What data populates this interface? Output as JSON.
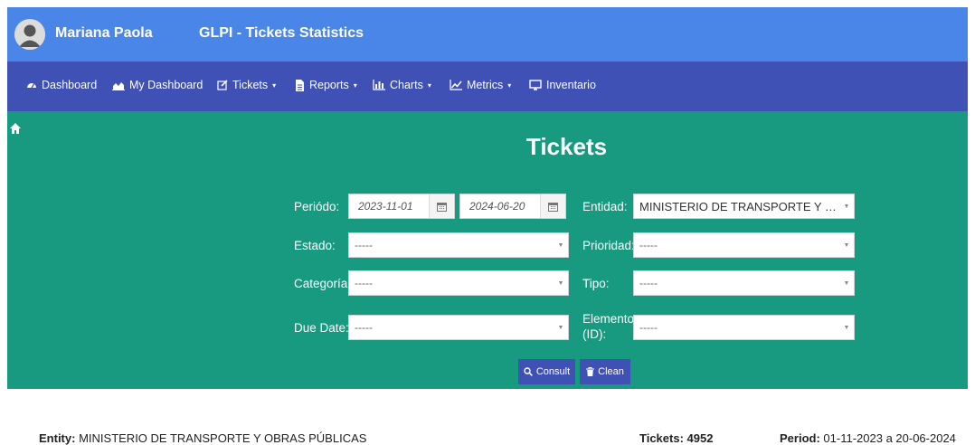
{
  "header": {
    "user_name": "Mariana Paola",
    "app_title": "GLPI - Tickets Statistics",
    "avatar_icon": "user-avatar-icon"
  },
  "nav": {
    "items": [
      {
        "label": "Dashboard",
        "icon": "dashboard-icon"
      },
      {
        "label": "My Dashboard",
        "icon": "area-chart-icon"
      },
      {
        "label": "Tickets",
        "icon": "edit-icon",
        "caret": "▾"
      },
      {
        "label": "Reports",
        "icon": "file-icon",
        "caret": "▾"
      },
      {
        "label": "Charts",
        "icon": "bar-chart-icon",
        "caret": "▾"
      },
      {
        "label": "Metrics",
        "icon": "line-chart-icon",
        "caret": "▾"
      },
      {
        "label": "Inventario",
        "icon": "monitor-icon"
      }
    ]
  },
  "panel": {
    "title": "Tickets",
    "home_icon": "home-icon",
    "periodo_label": "Periódo:",
    "date_from": "2023-11-01",
    "date_to": "2024-06-20",
    "entidad_label": "Entidad:",
    "entidad_value": "MINISTERIO DE TRANSPORTE Y OB...",
    "estado_label": "Estado:",
    "estado_value": "-----",
    "prioridad_label": "Prioridad:",
    "prioridad_value": "-----",
    "categoria_label": "Categoría:",
    "categoria_value": "-----",
    "tipo_label": "Tipo:",
    "tipo_value": "-----",
    "duedate_label": "Due Date:",
    "duedate_value": "-----",
    "elemento_label_1": "Elemento",
    "elemento_label_2": "(ID):",
    "elemento_value": "-----",
    "consult_label": "Consult",
    "clean_label": "Clean"
  },
  "footer": {
    "entity_label": "Entity:",
    "entity_value": "MINISTERIO DE TRANSPORTE Y OBRAS PÚBLICAS",
    "tickets_label": "Tickets:",
    "tickets_value": "4952",
    "period_label": "Period:",
    "period_value": "01-11-2023 a 20-06-2024"
  },
  "colors": {
    "header": "#4a86e8",
    "navbar": "#3f51b5",
    "panel": "#179a80",
    "button": "#3f51b5"
  }
}
